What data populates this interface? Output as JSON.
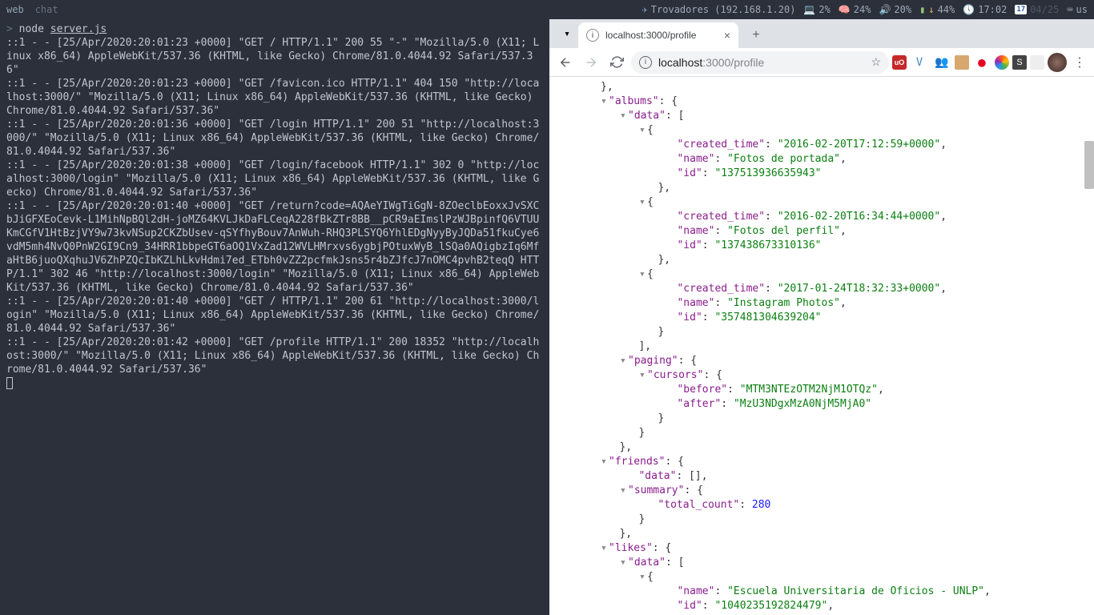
{
  "statusbar": {
    "workspaces": [
      "web",
      "chat"
    ],
    "network": {
      "label": "Trovadores (192.168.1.20)"
    },
    "cpu": "2%",
    "mem": "24%",
    "vol": "20%",
    "bat": "44%",
    "time": "17:02",
    "date_day": "17",
    "date": "04/25",
    "kb": "us"
  },
  "terminal": {
    "prompt": ">",
    "cmd_prefix": "node ",
    "cmd_file": "server.js",
    "log": "::1 - - [25/Apr/2020:20:01:23 +0000] \"GET / HTTP/1.1\" 200 55 \"-\" \"Mozilla/5.0 (X11; Linux x86_64) AppleWebKit/537.36 (KHTML, like Gecko) Chrome/81.0.4044.92 Safari/537.36\"\n::1 - - [25/Apr/2020:20:01:23 +0000] \"GET /favicon.ico HTTP/1.1\" 404 150 \"http://localhost:3000/\" \"Mozilla/5.0 (X11; Linux x86_64) AppleWebKit/537.36 (KHTML, like Gecko) Chrome/81.0.4044.92 Safari/537.36\"\n::1 - - [25/Apr/2020:20:01:36 +0000] \"GET /login HTTP/1.1\" 200 51 \"http://localhost:3000/\" \"Mozilla/5.0 (X11; Linux x86_64) AppleWebKit/537.36 (KHTML, like Gecko) Chrome/81.0.4044.92 Safari/537.36\"\n::1 - - [25/Apr/2020:20:01:38 +0000] \"GET /login/facebook HTTP/1.1\" 302 0 \"http://localhost:3000/login\" \"Mozilla/5.0 (X11; Linux x86_64) AppleWebKit/537.36 (KHTML, like Gecko) Chrome/81.0.4044.92 Safari/537.36\"\n::1 - - [25/Apr/2020:20:01:40 +0000] \"GET /return?code=AQAeYIWgTiGgN-8ZOeclbEoxxJvSXCbJiGFXEoCevk-L1MihNpBQl2dH-joMZ64KVLJkDaFLCeqA228fBkZTr8BB__pCR9aEImslPzWJBpinfQ6VTUUKmCGfV1HtBzjVY9w73kvNSup2CKZbUsev-qSYfhyBouv7AnWuh-RHQ3PLSYQ6YhlEDgNyyByJQDa51fkuCye6vdM5mh4NvQ0PnW2GI9Cn9_34HRR1bbpeGT6aOQ1VxZad12WVLHMrxvs6ygbjPOtuxWyB_lSQa0AQigbzIq6MfaHtB6juoQXqhuJV6ZhPZQcIbKZLhLkvHdmi7ed_ETbh0vZZ2pcfmkJsns5r4bZJfcJ7nOMC4pvhB2teqQ HTTP/1.1\" 302 46 \"http://localhost:3000/login\" \"Mozilla/5.0 (X11; Linux x86_64) AppleWebKit/537.36 (KHTML, like Gecko) Chrome/81.0.4044.92 Safari/537.36\"\n::1 - - [25/Apr/2020:20:01:40 +0000] \"GET / HTTP/1.1\" 200 61 \"http://localhost:3000/login\" \"Mozilla/5.0 (X11; Linux x86_64) AppleWebKit/537.36 (KHTML, like Gecko) Chrome/81.0.4044.92 Safari/537.36\"\n::1 - - [25/Apr/2020:20:01:42 +0000] \"GET /profile HTTP/1.1\" 200 18352 \"http://localhost:3000/\" \"Mozilla/5.0 (X11; Linux x86_64) AppleWebKit/537.36 (KHTML, like Gecko) Chrome/81.0.4044.92 Safari/537.36\""
  },
  "browser": {
    "tab_title": "localhost:3000/profile",
    "url_host": "localhost",
    "url_port_path": ":3000/profile"
  },
  "json": {
    "brace_close_comma": "},",
    "brace_close": "}",
    "bracket_close_comma": "],",
    "albums_key": "\"albums\"",
    "data_key": "\"data\"",
    "created_time_key": "\"created_time\"",
    "name_key": "\"name\"",
    "id_key": "\"id\"",
    "paging_key": "\"paging\"",
    "cursors_key": "\"cursors\"",
    "before_key": "\"before\"",
    "after_key": "\"after\"",
    "friends_key": "\"friends\"",
    "summary_key": "\"summary\"",
    "total_count_key": "\"total_count\"",
    "likes_key": "\"likes\"",
    "open_brace": "{",
    "open_bracket": "[",
    "colon_space": ": ",
    "album1_ct": "\"2016-02-20T17:12:59+0000\"",
    "album1_name": "\"Fotos de portada\"",
    "album1_id": "\"137513936635943\"",
    "album2_ct": "\"2016-02-20T16:34:44+0000\"",
    "album2_name": "\"Fotos del perfil\"",
    "album2_id": "\"137438673310136\"",
    "album3_ct": "\"2017-01-24T18:32:33+0000\"",
    "album3_name": "\"Instagram Photos\"",
    "album3_id": "\"357481304639204\"",
    "before_val": "\"MTM3NTEzOTM2NjM1OTQz\"",
    "after_val": "\"MzU3NDgxMzA0NjM5MjA0\"",
    "friends_data_empty": "[]",
    "total_count_val": "280",
    "like1_name": "\"Escuela Universitaria de Oficios - UNLP\"",
    "like1_id": "\"1040235192824479\"",
    "comma": ","
  }
}
